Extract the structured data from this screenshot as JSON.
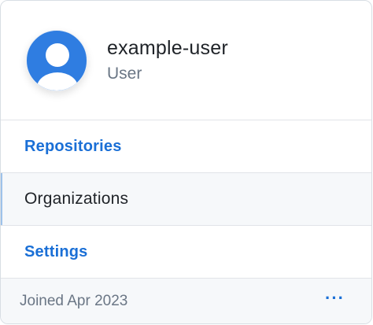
{
  "profile": {
    "username": "example-user",
    "role": "User",
    "avatar_icon": "user-silhouette-icon",
    "avatar_color": "#2f7de1"
  },
  "nav": {
    "items": [
      {
        "label": "Repositories",
        "active": false
      },
      {
        "label": "Organizations",
        "active": true
      },
      {
        "label": "Settings",
        "active": false
      }
    ]
  },
  "footer": {
    "joined": "Joined Apr 2023",
    "more_label": "···",
    "more_icon": "more-horizontal-icon"
  },
  "colors": {
    "link": "#1a6fd6",
    "active_bg": "#f6f8fa",
    "muted": "#6a7685"
  }
}
